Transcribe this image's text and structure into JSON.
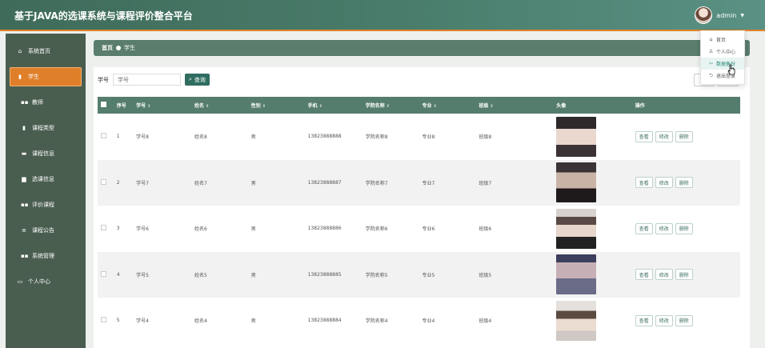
{
  "app": {
    "title": "基于JAVA的选课系统与课程评价整合平台",
    "username": "admin"
  },
  "user_menu": [
    {
      "label": "首页",
      "icon": "home-icon",
      "glyph": "⌂"
    },
    {
      "label": "个人中心",
      "icon": "user-icon",
      "glyph": "♙"
    },
    {
      "label": "数据备份",
      "icon": "backup-icon",
      "glyph": "⇦",
      "active": true
    },
    {
      "label": "退出登录",
      "icon": "logout-icon",
      "glyph": "⮌"
    }
  ],
  "sidebar": {
    "items": [
      {
        "label": "系统首页",
        "icon": "home-icon",
        "glyph": "⌂",
        "type": "plain"
      },
      {
        "label": "学生",
        "icon": "student-icon",
        "glyph": "▮",
        "type": "sub",
        "active": true
      },
      {
        "label": "教师",
        "icon": "grid-icon",
        "glyph": "▪▪",
        "type": "sub"
      },
      {
        "label": "课程类型",
        "icon": "document-icon",
        "glyph": "▮",
        "type": "sub"
      },
      {
        "label": "课程信息",
        "icon": "card-icon",
        "glyph": "▬",
        "type": "sub"
      },
      {
        "label": "选课信息",
        "icon": "briefcase-icon",
        "glyph": "▆",
        "type": "sub"
      },
      {
        "label": "评价课程",
        "icon": "grid-icon",
        "glyph": "▪▪",
        "type": "sub"
      },
      {
        "label": "课程公告",
        "icon": "list-icon",
        "glyph": "≡",
        "type": "sub"
      },
      {
        "label": "系统管理",
        "icon": "grid-icon",
        "glyph": "▪▪",
        "type": "sub"
      },
      {
        "label": "个人中心",
        "icon": "calendar-icon",
        "glyph": "▭",
        "type": "plain"
      }
    ]
  },
  "breadcrumb": {
    "home": "首页",
    "current": "学生"
  },
  "search": {
    "label": "学号",
    "placeholder": "学号",
    "button": "查询"
  },
  "table": {
    "columns": [
      "序号",
      "学号",
      "姓名",
      "性别",
      "手机",
      "学院名称",
      "专业",
      "班级",
      "头像",
      "操作"
    ],
    "sortable": [
      false,
      true,
      true,
      true,
      true,
      true,
      true,
      true,
      false,
      false
    ],
    "rows": [
      {
        "index": "1",
        "student_no": "学号8",
        "name": "姓名8",
        "gender": "男",
        "phone": "13823888888",
        "college": "学院名称8",
        "major": "专业8",
        "class": "班级8"
      },
      {
        "index": "2",
        "student_no": "学号7",
        "name": "姓名7",
        "gender": "男",
        "phone": "13823888887",
        "college": "学院名称7",
        "major": "专业7",
        "class": "班级7"
      },
      {
        "index": "3",
        "student_no": "学号6",
        "name": "姓名6",
        "gender": "男",
        "phone": "13823888886",
        "college": "学院名称6",
        "major": "专业6",
        "class": "班级6"
      },
      {
        "index": "4",
        "student_no": "学号5",
        "name": "姓名5",
        "gender": "男",
        "phone": "13823888885",
        "college": "学院名称5",
        "major": "专业5",
        "class": "班级5"
      },
      {
        "index": "5",
        "student_no": "学号4",
        "name": "姓名4",
        "gender": "男",
        "phone": "13823888884",
        "college": "学院名称4",
        "major": "专业4",
        "class": "班级4"
      }
    ],
    "actions": [
      "查看",
      "修改",
      "删除"
    ]
  },
  "colors": {
    "header": "#4a7d6c",
    "accent": "#e07f2a",
    "sidebar": "#4a5e50",
    "table_head": "#557d6d"
  }
}
